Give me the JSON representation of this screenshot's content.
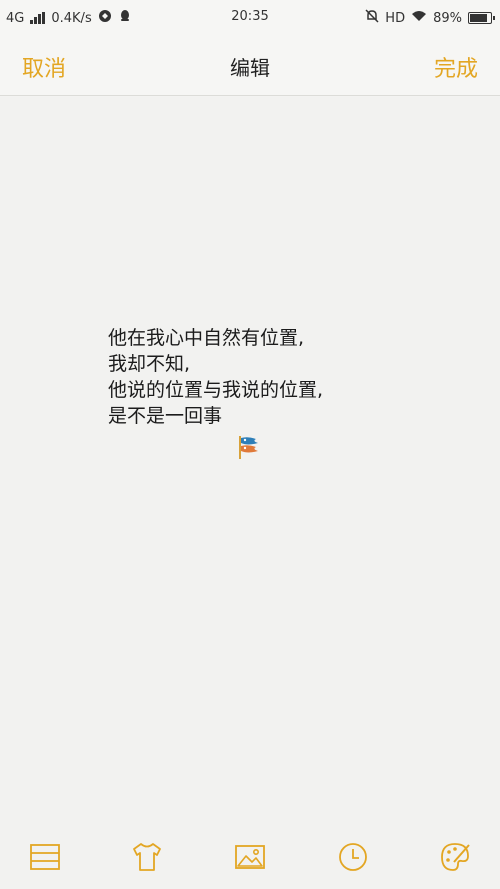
{
  "status_bar": {
    "network": "4G",
    "speed": "0.4K/s",
    "time": "20:35",
    "hd": "HD",
    "battery": "89%",
    "battery_level": 0.89
  },
  "nav": {
    "cancel_label": "取消",
    "title": "编辑",
    "done_label": "完成"
  },
  "note": {
    "lines": [
      "他在我心中自然有位置,",
      "我却不知,",
      "他说的位置与我说的位置,",
      "是不是一回事"
    ],
    "sticker": "flag-sticker-icon"
  },
  "toolbar": {
    "icons": [
      "list-icon",
      "shirt-icon",
      "image-icon",
      "clock-icon",
      "palette-icon"
    ],
    "accent": "#e3a623"
  }
}
